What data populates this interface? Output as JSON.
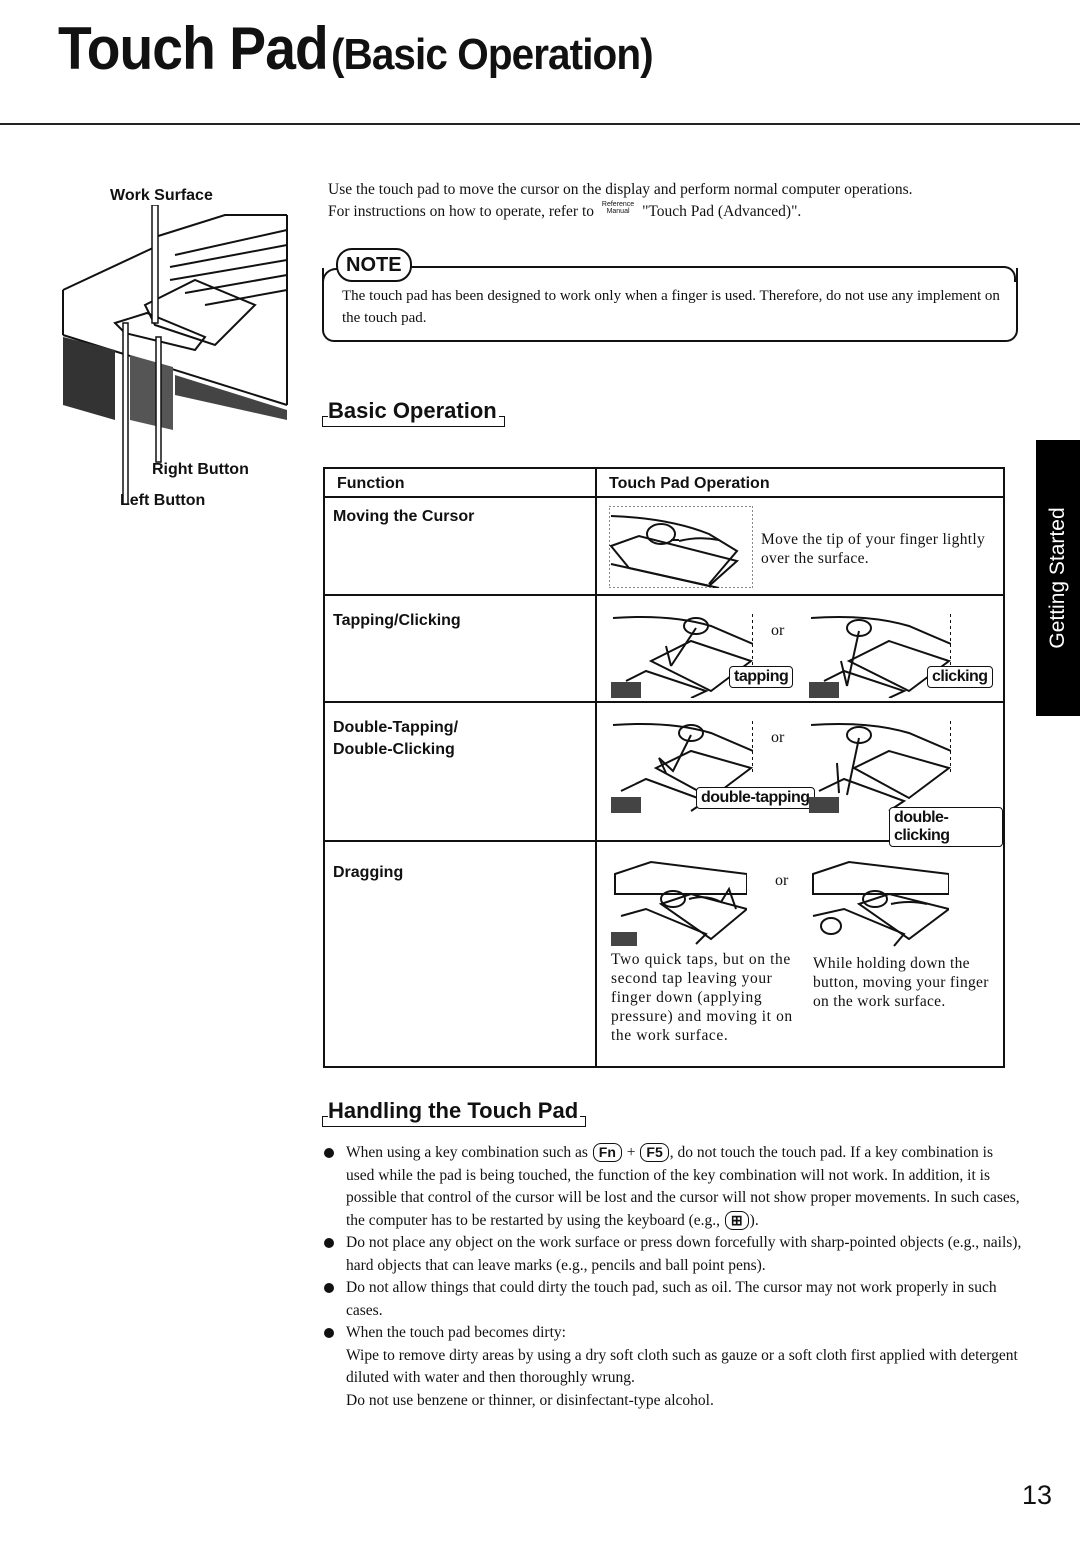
{
  "page": {
    "title_main": "Touch Pad",
    "title_sub": "(Basic Operation)",
    "page_number": "13",
    "side_tab": "Getting Started"
  },
  "diagram": {
    "labels": {
      "work_surface": "Work Surface",
      "right_button": "Right Button",
      "left_button": "Left Button"
    }
  },
  "intro": {
    "line1": "Use the touch pad to move the cursor on the display and perform normal computer operations.",
    "line2_prefix": "For instructions on how to operate, refer to",
    "ref_top": "Reference",
    "ref_bottom": "Manual",
    "line2_suffix": "\"Touch Pad (Advanced)\"."
  },
  "note": {
    "tag": "NOTE",
    "text": "The touch pad has been designed to work only when a finger is used.  Therefore, do not use any implement on the touch pad."
  },
  "basic_operation": {
    "heading": "Basic Operation",
    "table": {
      "headers": [
        "Function",
        "Touch Pad Operation"
      ],
      "rows": [
        {
          "function": "Moving the Cursor",
          "description": "Move the tip of your finger lightly over the surface."
        },
        {
          "function": "Tapping/Clicking",
          "callouts": [
            "tapping",
            "clicking"
          ],
          "or": "or"
        },
        {
          "function_line1": "Double-Tapping/",
          "function_line2": "Double-Clicking",
          "callouts": [
            "double-tapping",
            "double-clicking"
          ],
          "or": "or"
        },
        {
          "function": "Dragging",
          "or": "or",
          "left_desc": "Two quick taps, but on the second tap leaving your finger down (applying pressure) and moving it on the work surface.",
          "right_desc": "While holding down the button, moving your finger on the work surface."
        }
      ]
    }
  },
  "handling": {
    "heading": "Handling the Touch Pad",
    "bullet1_a": "When using a key combination such as",
    "key_fn": "Fn",
    "plus": "+",
    "key_f5": "F5",
    "bullet1_b": ", do not touch the touch pad.  If a key combination is used while the pad is being touched, the function of the key combination will not work.  In addition, it is possible that control of the cursor will be lost and the cursor will not show proper movements.  In such cases, the computer has to be restarted by using the keyboard (e.g.,",
    "key_win": "⊞",
    "bullet1_c": ").",
    "bullet2": "Do not place any object on the work surface or press down forcefully with sharp-pointed objects (e.g., nails), hard objects that can leave marks (e.g., pencils and ball point pens).",
    "bullet3": "Do not allow things that could dirty the touch pad, such as oil.  The cursor may not work properly in such cases.",
    "bullet4": "When the touch pad becomes dirty:",
    "bullet4_p1": "Wipe to remove dirty areas by using a dry soft cloth such as gauze or a soft cloth first applied with detergent diluted with water and then thoroughly wrung.",
    "bullet4_p2": "Do not use benzene or thinner, or disinfectant-type alcohol."
  }
}
